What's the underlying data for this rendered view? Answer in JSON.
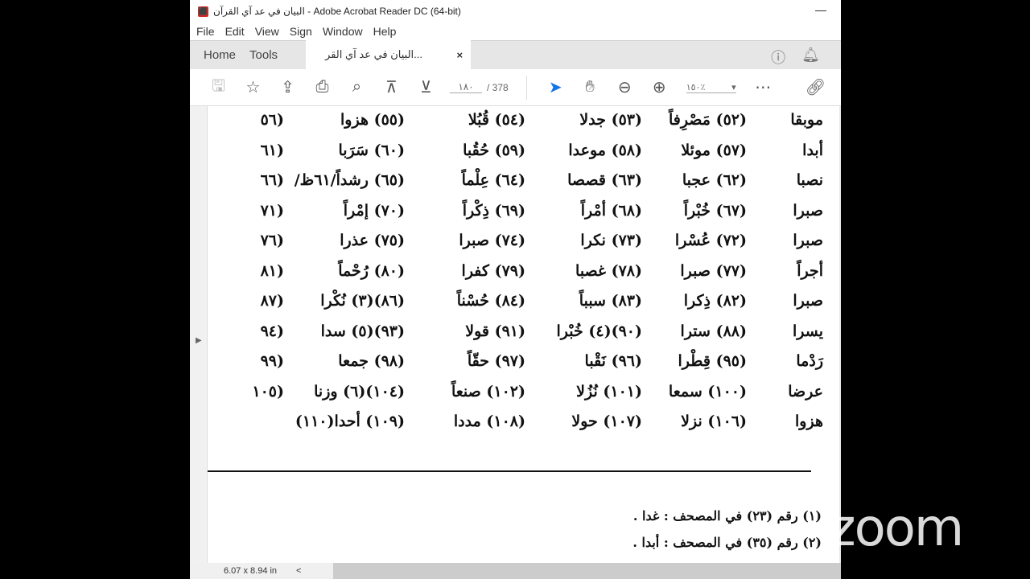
{
  "window": {
    "title": "البيان في عد آي القرآن - Adobe Acrobat Reader DC (64-bit)",
    "minimize": "—"
  },
  "menu": [
    "File",
    "Edit",
    "View",
    "Sign",
    "Window",
    "Help"
  ],
  "tabs": {
    "home": "Home",
    "tools": "Tools",
    "doc": "البيان في عد آي القر...",
    "close": "×"
  },
  "toolbar": {
    "page_current": "١٨٠",
    "page_total": "/ 378",
    "zoom": "١٥٠٪"
  },
  "rows": [
    [
      "موبقا",
      "(٥٢) مَصْرِفاً",
      "(٥٣) جدلا",
      "(٥٤) قُبُلا",
      "(٥٥) هزوا",
      "(٥٦"
    ],
    [
      "أبدا",
      "(٥٧) موئلا",
      "(٥٨) موعدا",
      "(٥٩) حُقُبا",
      "(٦٠) سَرَبا",
      "(٦١"
    ],
    [
      "نصبا",
      "(٦٢) عجبا",
      "(٦٣) قصصا",
      "(٦٤) عِلْماً",
      "(٦٥) رشداً/٦١ظ/",
      "(٦٦"
    ],
    [
      "صبرا",
      "(٦٧) خُبْراً",
      "(٦٨) أمْراً",
      "(٦٩) ذِكْراً",
      "(٧٠) إمْراً",
      "(٧١"
    ],
    [
      "صبرا",
      "(٧٢) عُسْرا",
      "(٧٣) نكرا",
      "(٧٤) صبرا",
      "(٧٥) عذرا",
      "(٧٦"
    ],
    [
      "أجراً",
      "(٧٧) صبرا",
      "(٧٨) غصبا",
      "(٧٩) كفرا",
      "(٨٠) رُحْماً",
      "(٨١"
    ],
    [
      "صبرا",
      "(٨٢) ذِكرا",
      "(٨٣) سبباً",
      "(٨٤) حُسْناً",
      "(٨٦)(٣) نُكْرا",
      "(٨٧"
    ],
    [
      "يسرا",
      "(٨٨) سترا",
      "(٩٠)(٤) خُبْرا",
      "(٩١) قولا",
      "(٩٣)(٥) سدا",
      "(٩٤"
    ],
    [
      "رَدْما",
      "(٩٥) قِطْرا",
      "(٩٦) نَقْبا",
      "(٩٧) حقّاً",
      "(٩٨) جمعا",
      "(٩٩"
    ],
    [
      "عرضا",
      "(١٠٠) سمعا",
      "(١٠١) نُزُلا",
      "(١٠٢) صنعاً",
      "(١٠٤)(٦) وزنا",
      "(١٠٥"
    ],
    [
      "هزوا",
      "(١٠٦) نزلا",
      "(١٠٧) حولا",
      "(١٠٨) مددا",
      "(١٠٩) أحدا(١١٠)",
      ""
    ]
  ],
  "footnotes": [
    "(١)  رقم (٢٣) في المصحف : غدا .",
    "(٢)  رقم (٣٥) في المصحف : أبدا ."
  ],
  "status": {
    "dimensions": "6.07 x 8.94 in",
    "scroll_left": "<"
  },
  "overlay": {
    "logo": "zoom"
  }
}
